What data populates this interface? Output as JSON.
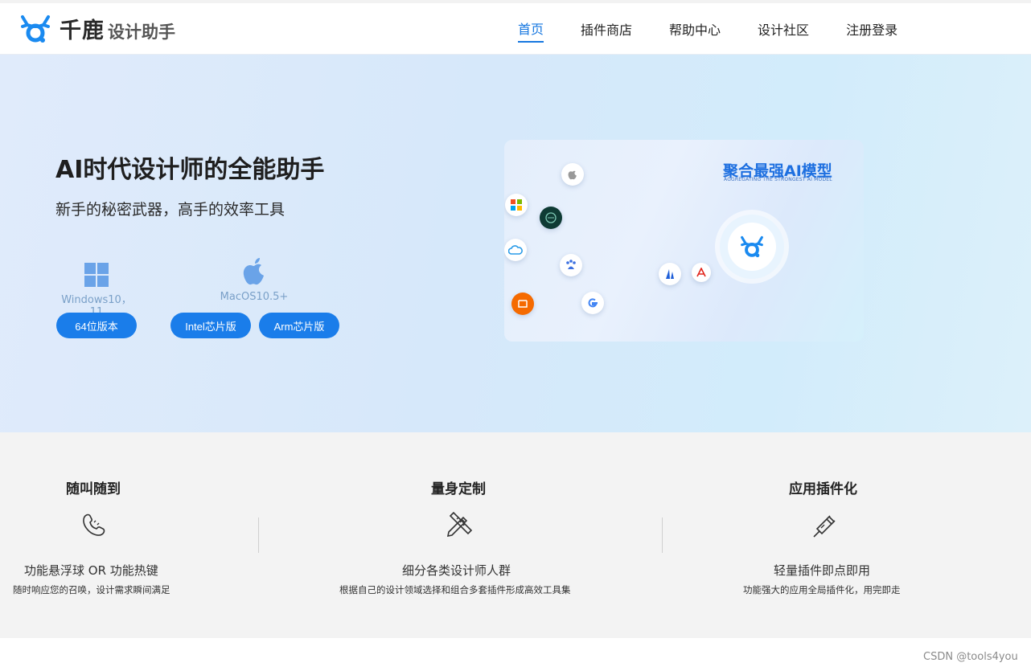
{
  "brand": {
    "name": "千鹿",
    "sub": "设计助手",
    "accent": "#1a7dea"
  },
  "nav": {
    "items": [
      {
        "label": "首页",
        "active": true
      },
      {
        "label": "插件商店",
        "active": false
      },
      {
        "label": "帮助中心",
        "active": false
      },
      {
        "label": "设计社区",
        "active": false
      },
      {
        "label": "注册登录",
        "active": false
      }
    ]
  },
  "hero": {
    "title": "AI时代设计师的全能助手",
    "subtitle": "新手的秘密武器，高手的效率工具",
    "downloads": [
      {
        "os_label": "Windows10，11",
        "icon": "windows-icon",
        "buttons": [
          "64位版本"
        ]
      },
      {
        "os_label": "MacOS10.5+",
        "icon": "apple-icon",
        "buttons": [
          "Intel芯片版",
          "Arm芯片版"
        ]
      }
    ],
    "card": {
      "title": "聚合最强AI模型",
      "subtitle": "AGGREGATING THE STRONGEST AI MODEL",
      "model_icons": [
        "apple-icon",
        "microsoft-icon",
        "openai-icon",
        "cloud-icon",
        "baidu-icon",
        "alibaba-icon",
        "google-icon",
        "midjourney-icon",
        "adobe-icon"
      ],
      "center_icon": "qianlu-logo-icon"
    }
  },
  "features": [
    {
      "title": "随叫随到",
      "icon": "phone-hand-icon",
      "main": "功能悬浮球 OR 功能热键",
      "desc": "随时响应您的召唤，设计需求瞬间满足"
    },
    {
      "title": "量身定制",
      "icon": "pencil-ruler-icon",
      "main": "细分各类设计师人群",
      "desc": "根据自己的设计领域选择和组合多套插件形成高效工具集"
    },
    {
      "title": "应用插件化",
      "icon": "plug-icon",
      "main": "轻量插件即点即用",
      "desc": "功能强大的应用全局插件化，用完即走"
    }
  ],
  "watermark": "CSDN @tools4you"
}
